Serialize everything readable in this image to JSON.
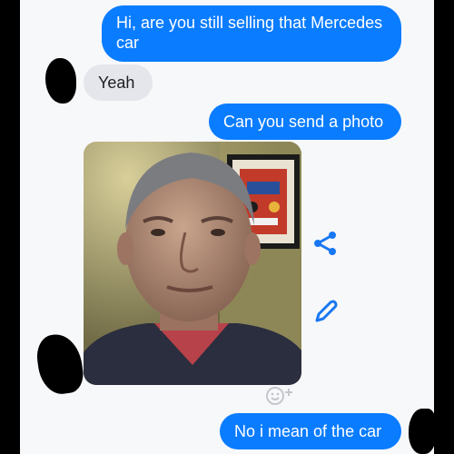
{
  "messages": [
    {
      "from": "me",
      "text": "Hi, are you still selling that Mercedes car"
    },
    {
      "from": "them",
      "text": "Yeah"
    },
    {
      "from": "me",
      "text": "Can you send a photo"
    },
    {
      "from": "them",
      "type": "photo"
    },
    {
      "from": "me",
      "text": "No i mean of the car"
    }
  ],
  "icons": {
    "share": "share-icon",
    "edit": "pencil-icon",
    "react": "add-reaction-icon"
  },
  "colors": {
    "outgoing_bubble": "#0a7cff",
    "incoming_bubble": "#e4e6eb",
    "background": "#f7f8fa",
    "accent_icon": "#1877f2"
  }
}
